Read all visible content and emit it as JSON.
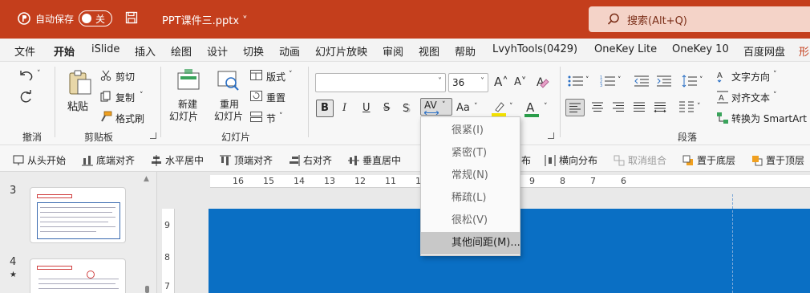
{
  "titlebar": {
    "autosave_label": "自动保存",
    "toggle_state": "关",
    "doc_title": "PPT课件三.pptx ˅",
    "search_placeholder": "搜索(Alt+Q)"
  },
  "tabs": [
    "文件",
    "开始",
    "iSlide",
    "插入",
    "绘图",
    "设计",
    "切换",
    "动画",
    "幻灯片放映",
    "审阅",
    "视图",
    "帮助",
    "LvyhTools(0429)",
    "OneKey Lite",
    "OneKey 10",
    "百度网盘",
    "形"
  ],
  "active_tab": "开始",
  "ribbon": {
    "undo_group_label": "撤消",
    "clipboard": {
      "paste": "粘贴",
      "cut": "剪切",
      "copy": "复制",
      "format_painter": "格式刷",
      "label": "剪贴板"
    },
    "slides": {
      "new_slide": [
        "新建",
        "幻灯片"
      ],
      "reuse_slide": [
        "重用",
        "幻灯片"
      ],
      "layout": "版式",
      "reset": "重置",
      "section": "节",
      "label": "幻灯片"
    },
    "font": {
      "font_name": "",
      "font_size": "36",
      "bold": "B",
      "italic": "I",
      "underline": "U",
      "strike": "S",
      "spacing": "AV",
      "case": "Aa"
    },
    "paragraph": {
      "text_direction": "文字方向",
      "align_text": "对齐文本",
      "smartart": "转换为 SmartArt",
      "label": "段落"
    }
  },
  "quick_toolbar": [
    {
      "label": "从头开始",
      "icon": "slideshow-icon",
      "disabled": false
    },
    {
      "label": "底端对齐",
      "icon": "align-bottom-icon",
      "disabled": false
    },
    {
      "label": "水平居中",
      "icon": "align-hcenter-icon",
      "disabled": false
    },
    {
      "label": "顶端对齐",
      "icon": "align-top-icon",
      "disabled": false
    },
    {
      "label": "右对齐",
      "icon": "align-right-icon",
      "disabled": false
    },
    {
      "label": "垂直居中",
      "icon": "align-vcenter-icon",
      "disabled": false
    },
    {
      "label": "布",
      "icon": "",
      "disabled": false
    },
    {
      "label": "横向分布",
      "icon": "distribute-h-icon",
      "disabled": false
    },
    {
      "label": "取消组合",
      "icon": "ungroup-icon",
      "disabled": true
    },
    {
      "label": "置于底层",
      "icon": "send-back-icon",
      "disabled": false
    },
    {
      "label": "置于顶层",
      "icon": "bring-front-icon",
      "disabled": false
    }
  ],
  "slides_panel": {
    "items": [
      {
        "number": "3",
        "star": ""
      },
      {
        "number": "4",
        "star": "★"
      }
    ]
  },
  "ruler": {
    "top_labels": [
      "16",
      "15",
      "14",
      "13",
      "12",
      "11",
      "10",
      "9",
      "8",
      "7",
      "6"
    ],
    "left_labels": [
      "9",
      "8",
      "7"
    ]
  },
  "spacing_menu": {
    "items": [
      "很紧(I)",
      "紧密(T)",
      "常规(N)",
      "稀疏(L)",
      "很松(V)",
      "其他间距(M)..."
    ],
    "highlighted_index": 5
  },
  "colors": {
    "accent": "#c43e1c",
    "slide_bg": "#0a6fc4",
    "highlight_yellow": "#f5e300",
    "font_color_green": "#2a9d4a"
  }
}
